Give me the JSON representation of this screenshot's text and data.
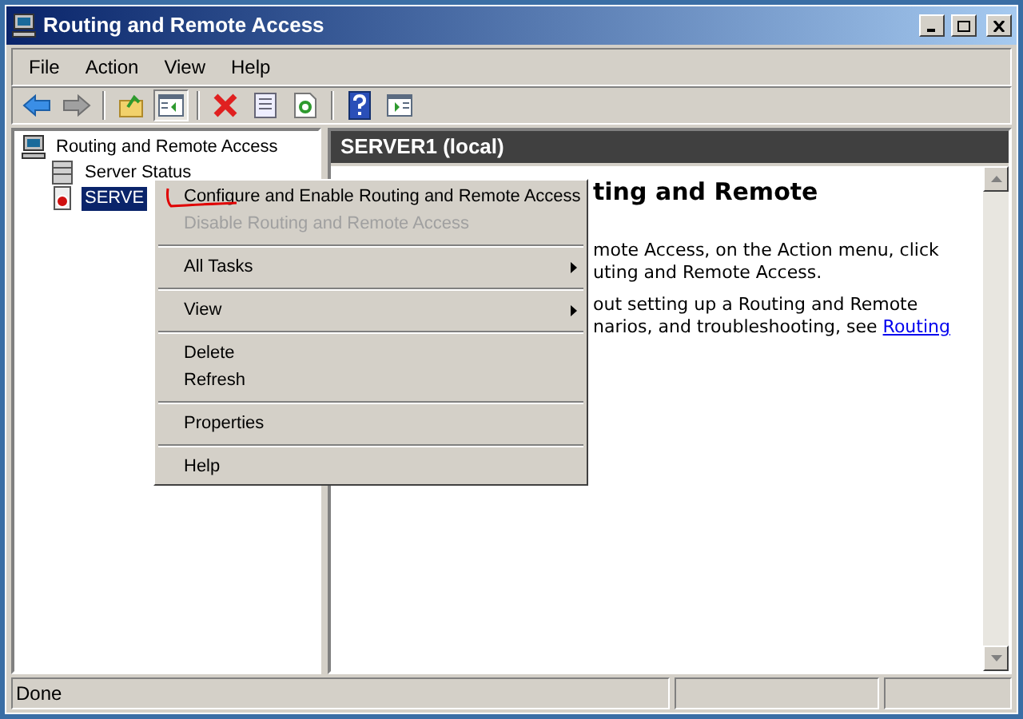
{
  "window": {
    "title": "Routing and Remote Access"
  },
  "menu_bar": [
    "File",
    "Action",
    "View",
    "Help"
  ],
  "toolbar": [
    {
      "kind": "back",
      "pressed": false
    },
    {
      "kind": "forward",
      "pressed": false
    },
    {
      "kind": "separator"
    },
    {
      "kind": "up",
      "pressed": false
    },
    {
      "kind": "tree",
      "pressed": true
    },
    {
      "kind": "separator"
    },
    {
      "kind": "delete",
      "pressed": false
    },
    {
      "kind": "properties",
      "pressed": false
    },
    {
      "kind": "refresh",
      "pressed": false
    },
    {
      "kind": "separator"
    },
    {
      "kind": "help",
      "pressed": false
    },
    {
      "kind": "panel",
      "pressed": false
    }
  ],
  "tree": [
    {
      "label": "Routing and Remote Access",
      "kind": "root",
      "selected": false,
      "children": [
        {
          "label": "Server Status",
          "kind": "status",
          "selected": false
        },
        {
          "label": "SERVE",
          "kind": "server",
          "selected": true
        }
      ]
    }
  ],
  "pane": {
    "header": "SERVER1 (local)",
    "heading": "ting and Remote",
    "lines": [
      "mote Access, on the Action menu, click",
      "uting and Remote Access."
    ],
    "lines2": [
      "out setting up a Routing and Remote",
      "narios, and troubleshooting, see"
    ],
    "link": "Routing"
  },
  "context_menu": [
    {
      "kind": "item",
      "label": "Configure and Enable Routing and Remote Access",
      "disabled": false,
      "submenu": false,
      "marked": true
    },
    {
      "kind": "item",
      "label": "Disable Routing and Remote Access",
      "disabled": true,
      "submenu": false,
      "marked": false
    },
    {
      "kind": "separator"
    },
    {
      "kind": "item",
      "label": "All Tasks",
      "disabled": false,
      "submenu": true,
      "marked": false
    },
    {
      "kind": "separator"
    },
    {
      "kind": "item",
      "label": "View",
      "disabled": false,
      "submenu": true,
      "marked": false
    },
    {
      "kind": "separator"
    },
    {
      "kind": "item",
      "label": "Delete",
      "disabled": false,
      "submenu": false,
      "marked": false
    },
    {
      "kind": "item",
      "label": "Refresh",
      "disabled": false,
      "submenu": false,
      "marked": false
    },
    {
      "kind": "separator"
    },
    {
      "kind": "item",
      "label": "Properties",
      "disabled": false,
      "submenu": false,
      "marked": false
    },
    {
      "kind": "separator"
    },
    {
      "kind": "item",
      "label": "Help",
      "disabled": false,
      "submenu": false,
      "marked": false
    }
  ],
  "status_bar": [
    "Done"
  ]
}
